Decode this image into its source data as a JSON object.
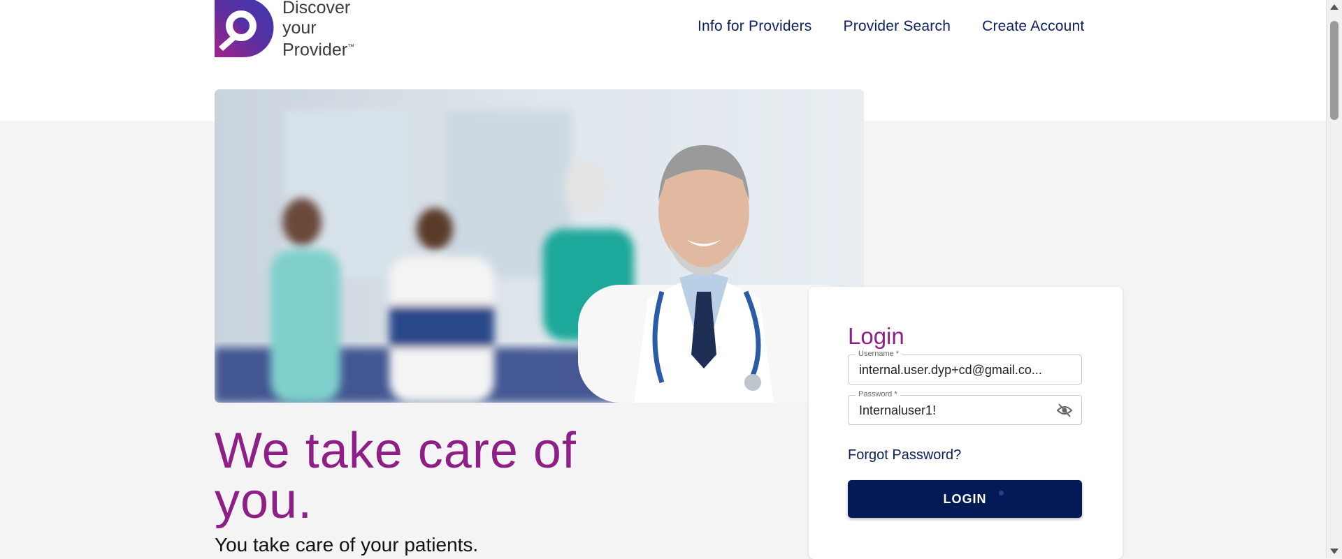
{
  "brand": {
    "line1": "Discover",
    "line2": "your",
    "line3": "Provider",
    "tm": "™"
  },
  "nav": {
    "info": "Info for Providers",
    "search": "Provider Search",
    "create": "Create Account"
  },
  "hero": {
    "headline": "We take care of you.",
    "subhead": "You take care of your patients."
  },
  "login": {
    "title": "Login",
    "username_label": "Username *",
    "username_value": "internal.user.dyp+cd@gmail.co...",
    "password_label": "Password *",
    "password_value": "Internaluser1!",
    "forgot": "Forgot Password?",
    "button": "LOGIN"
  },
  "colors": {
    "brand_purple": "#8e1f87",
    "navy": "#031a57"
  }
}
